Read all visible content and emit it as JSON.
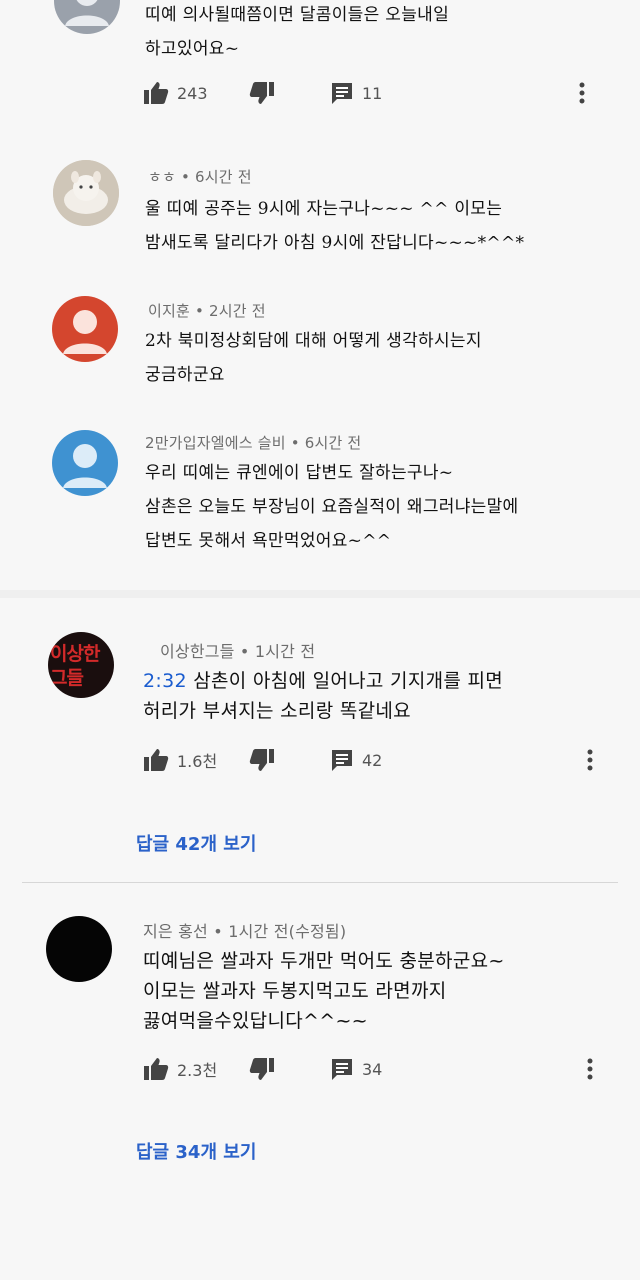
{
  "comments": [
    {
      "author": "",
      "time": "",
      "text_lines": [
        "띠예 의사될때쯤이면 달콤이들은 오늘내일",
        "하고있어요~"
      ],
      "likes": "243",
      "replies": "11",
      "avatar": "default-grey"
    },
    {
      "author": "ㅎㅎ",
      "time": "6시간 전",
      "text_lines": [
        "울 띠예 공주는 9시에 자는구나~~~ ^^ 이모는",
        "밤새도록 달리다가 아침 9시에 잔답니다~~~*^^*"
      ],
      "avatar": "photo"
    },
    {
      "author": "이지훈",
      "time": "2시간 전",
      "text_lines": [
        "2차 북미정상회담에 대해 어떻게 생각하시는지",
        "궁금하군요"
      ],
      "avatar": "default-red"
    },
    {
      "author": "2만가입자엘에스 슬비",
      "time": "6시간 전",
      "text_lines": [
        "우리 띠예는 큐엔에이 답변도 잘하는구나~",
        "삼촌은 오늘도 부장님이 요즘실적이 왜그러냐는말에",
        "답변도 못해서 욕만먹었어요~^^"
      ],
      "avatar": "default-blue"
    },
    {
      "author": "이상한그들",
      "time": "1시간 전",
      "timestamp": "2:32",
      "text_line1_rest": "삼촌이 아침에 일어나고 기지개를 피면",
      "text_line2": "허리가 부셔지는 소리랑 똑같네요",
      "likes": "1.6천",
      "replies": "42",
      "view_replies": {
        "prefix": "답글",
        "count": "42개",
        "suffix": "보기"
      },
      "avatar_text": [
        "이상한",
        "그들"
      ]
    },
    {
      "author": "지은 홍선",
      "time": "1시간 전(수정됨)",
      "text_lines": [
        "띠예님은 쌀과자 두개만 먹어도 충분하군요~",
        "이모는 쌀과자 두봉지먹고도 라면까지",
        "끓여먹을수있답니다^^~~"
      ],
      "likes": "2.3천",
      "replies": "34",
      "view_replies": {
        "prefix": "답글",
        "count": "34개",
        "suffix": "보기"
      },
      "avatar": "black"
    }
  ],
  "separator": "•",
  "icons": {
    "like": "thumbs-up-icon",
    "dislike": "thumbs-down-icon",
    "reply": "comment-icon",
    "more": "more-vertical-icon"
  },
  "colors": {
    "link": "#2b62c9",
    "timestamp": "#1a5ccf",
    "meta": "#6d6d6d"
  }
}
